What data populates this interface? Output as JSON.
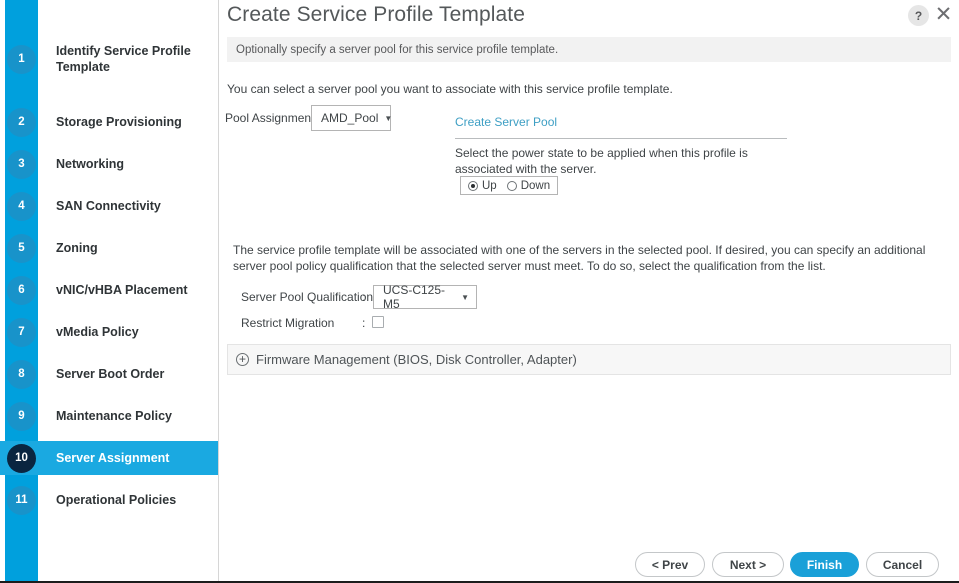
{
  "window": {
    "title": "Create Service Profile Template",
    "help_icon": "question-mark-icon",
    "close_icon": "close-x-icon",
    "subtitle": "Optionally specify a server pool for this service profile template."
  },
  "sidebar": {
    "steps": [
      {
        "number": "1",
        "label": "Identify Service Profile Template",
        "active": false
      },
      {
        "number": "2",
        "label": "Storage Provisioning",
        "active": false
      },
      {
        "number": "3",
        "label": "Networking",
        "active": false
      },
      {
        "number": "4",
        "label": "SAN Connectivity",
        "active": false
      },
      {
        "number": "5",
        "label": "Zoning",
        "active": false
      },
      {
        "number": "6",
        "label": "vNIC/vHBA Placement",
        "active": false
      },
      {
        "number": "7",
        "label": "vMedia Policy",
        "active": false
      },
      {
        "number": "8",
        "label": "Server Boot Order",
        "active": false
      },
      {
        "number": "9",
        "label": "Maintenance Policy",
        "active": false
      },
      {
        "number": "10",
        "label": "Server Assignment",
        "active": true
      },
      {
        "number": "11",
        "label": "Operational Policies",
        "active": false
      }
    ]
  },
  "main": {
    "intro_text": "You can select a server pool you want to associate with this service profile template.",
    "pool_assignment": {
      "label": "Pool Assignment:",
      "value": "AMD_Pool",
      "caret": "▼"
    },
    "create_server_pool_link": "Create Server Pool",
    "power_state": {
      "description": "Select the power state to be applied when this profile is associated with the server.",
      "options": [
        {
          "label": "Up",
          "selected": true
        },
        {
          "label": "Down",
          "selected": false
        }
      ]
    },
    "association_text": "The service profile template will be associated with one of the servers in the selected pool. If desired, you can specify an additional server pool policy qualification that the selected server must meet. To do so, select the qualification from the list.",
    "server_pool_qualification": {
      "label": "Server Pool Qualification",
      "colon": ":",
      "value": "UCS-C125-M5",
      "caret": "▼"
    },
    "restrict_migration": {
      "label": "Restrict Migration",
      "colon": ":",
      "checked": false
    },
    "firmware_management": {
      "expand_icon": "plus-circle-icon",
      "expand_glyph": "+",
      "label": "Firmware Management (BIOS, Disk Controller, Adapter)"
    }
  },
  "footer": {
    "prev_label": "< Prev",
    "next_label": "Next >",
    "finish_label": "Finish",
    "cancel_label": "Cancel"
  },
  "colors": {
    "accent_blue": "#00a0dd",
    "active_step_blue": "#1aa9e1",
    "active_badge_navy": "#0a2540",
    "link_blue": "#3e9fc4",
    "primary_button": "#1aa0d8"
  }
}
